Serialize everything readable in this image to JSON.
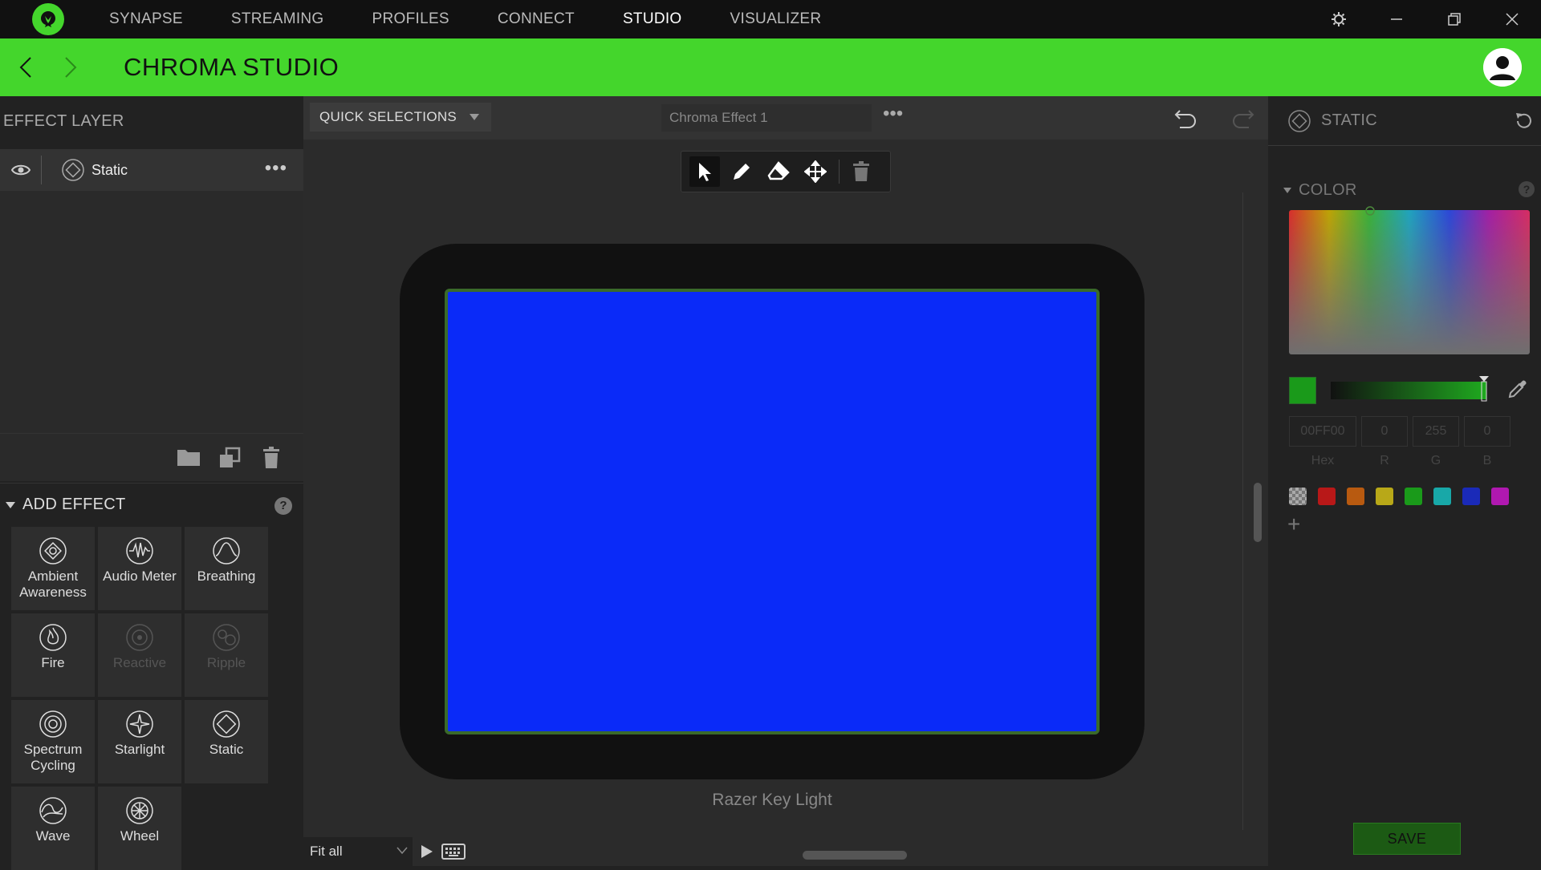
{
  "nav": {
    "items": [
      {
        "label": "SYNAPSE",
        "active": false
      },
      {
        "label": "STREAMING",
        "active": false
      },
      {
        "label": "PROFILES",
        "active": false
      },
      {
        "label": "CONNECT",
        "active": false
      },
      {
        "label": "STUDIO",
        "active": true
      },
      {
        "label": "VISUALIZER",
        "active": false
      }
    ]
  },
  "header": {
    "title": "CHROMA STUDIO"
  },
  "effect_layer": {
    "title": "EFFECT LAYER",
    "layers": [
      {
        "name": "Static"
      }
    ]
  },
  "add_effect": {
    "title": "ADD EFFECT",
    "help": "?",
    "effects": [
      {
        "label": "Ambient Awareness",
        "icon": "ambient-awareness-icon",
        "enabled": true
      },
      {
        "label": "Audio Meter",
        "icon": "audio-meter-icon",
        "enabled": true
      },
      {
        "label": "Breathing",
        "icon": "breathing-icon",
        "enabled": true
      },
      {
        "label": "Fire",
        "icon": "fire-icon",
        "enabled": true
      },
      {
        "label": "Reactive",
        "icon": "reactive-icon",
        "enabled": false
      },
      {
        "label": "Ripple",
        "icon": "ripple-icon",
        "enabled": false
      },
      {
        "label": "Spectrum Cycling",
        "icon": "spectrum-cycling-icon",
        "enabled": true
      },
      {
        "label": "Starlight",
        "icon": "starlight-icon",
        "enabled": true
      },
      {
        "label": "Static",
        "icon": "static-icon",
        "enabled": true
      },
      {
        "label": "Wave",
        "icon": "wave-icon",
        "enabled": true
      },
      {
        "label": "Wheel",
        "icon": "wheel-icon",
        "enabled": true
      }
    ]
  },
  "toolbar": {
    "quick_selections": "QUICK SELECTIONS",
    "effect_name": "Chroma Effect 1",
    "more": "•••"
  },
  "canvas": {
    "device_name": "Razer Key Light",
    "screen_color": "#0a2af8",
    "zoom": "Fit all"
  },
  "right_panel": {
    "title": "STATIC",
    "color_section": "COLOR",
    "help": "?",
    "current_color": "#1a9a1a",
    "hex_value": "00FF00",
    "r_value": "0",
    "g_value": "255",
    "b_value": "0",
    "hex_label": "Hex",
    "r_label": "R",
    "g_label": "G",
    "b_label": "B",
    "presets": [
      "#b81818",
      "#b85a10",
      "#b8a818",
      "#1a9a1a",
      "#18a8a8",
      "#1a2ab8",
      "#b018b0"
    ],
    "save_label": "SAVE"
  },
  "colors": {
    "accent": "#44d62c",
    "bg": "#222222"
  }
}
